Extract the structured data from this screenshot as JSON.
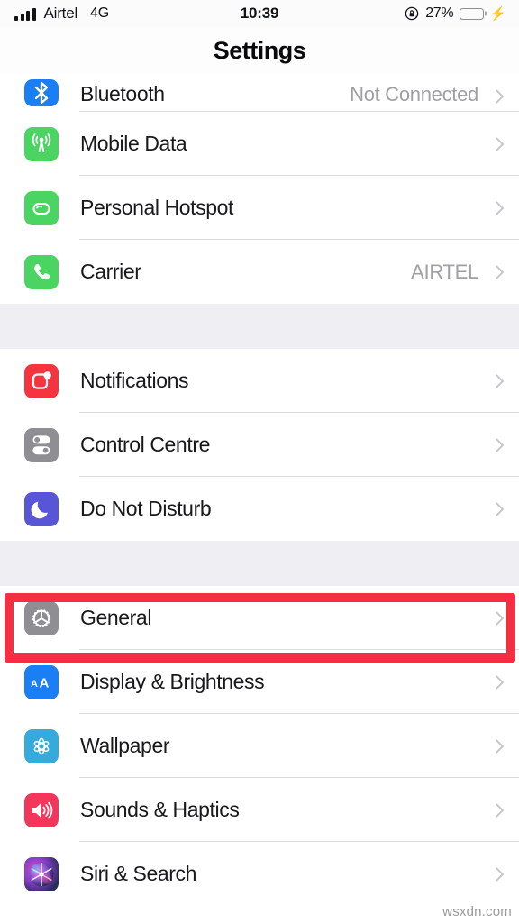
{
  "status_bar": {
    "carrier": "Airtel",
    "network": "4G",
    "time": "10:39",
    "battery_percent": "27%",
    "battery_level": 27,
    "rotation_lock_icon": "rotation-lock-icon",
    "charging_icon": "charging-bolt-icon",
    "signal_bars": 4
  },
  "nav": {
    "title": "Settings"
  },
  "groups": [
    {
      "id": "connectivity",
      "rows": [
        {
          "label": "Bluetooth",
          "value": "Not Connected",
          "icon": "bluetooth-icon",
          "icon_class": "ic-bluetooth",
          "clipped": true
        },
        {
          "label": "Mobile Data",
          "value": "",
          "icon": "mobile-data-icon",
          "icon_class": "ic-mobiledata",
          "clipped": false
        },
        {
          "label": "Personal Hotspot",
          "value": "",
          "icon": "personal-hotspot-icon",
          "icon_class": "ic-hotspot",
          "clipped": false
        },
        {
          "label": "Carrier",
          "value": "AIRTEL",
          "icon": "carrier-phone-icon",
          "icon_class": "ic-carrier",
          "clipped": false
        }
      ]
    },
    {
      "id": "alerts",
      "rows": [
        {
          "label": "Notifications",
          "value": "",
          "icon": "notifications-icon",
          "icon_class": "ic-notifications",
          "clipped": false
        },
        {
          "label": "Control Centre",
          "value": "",
          "icon": "control-centre-icon",
          "icon_class": "ic-controlcentre",
          "clipped": false
        },
        {
          "label": "Do Not Disturb",
          "value": "",
          "icon": "do-not-disturb-moon-icon",
          "icon_class": "ic-dnd",
          "clipped": false
        }
      ]
    },
    {
      "id": "system",
      "rows": [
        {
          "label": "General",
          "value": "",
          "icon": "general-gear-icon",
          "icon_class": "ic-general",
          "clipped": false
        },
        {
          "label": "Display & Brightness",
          "value": "",
          "icon": "display-brightness-icon",
          "icon_class": "ic-display",
          "clipped": false
        },
        {
          "label": "Wallpaper",
          "value": "",
          "icon": "wallpaper-icon",
          "icon_class": "ic-wallpaper",
          "clipped": false
        },
        {
          "label": "Sounds & Haptics",
          "value": "",
          "icon": "sounds-haptics-icon",
          "icon_class": "ic-sounds",
          "clipped": false
        },
        {
          "label": "Siri & Search",
          "value": "",
          "icon": "siri-search-icon",
          "icon_class": "ic-siri",
          "clipped": false
        }
      ]
    }
  ],
  "annotation": {
    "target_row": "General",
    "color": "#f42f41"
  },
  "watermark": {
    "text": "wsxdn.com"
  },
  "colors": {
    "accent_blue": "#1a7ef4",
    "green": "#4cd462",
    "red": "#f4343f",
    "gray": "#8e8e93",
    "purple": "#5856d6",
    "group_bg": "#eeeef3",
    "value_text": "#a0a0a5"
  }
}
